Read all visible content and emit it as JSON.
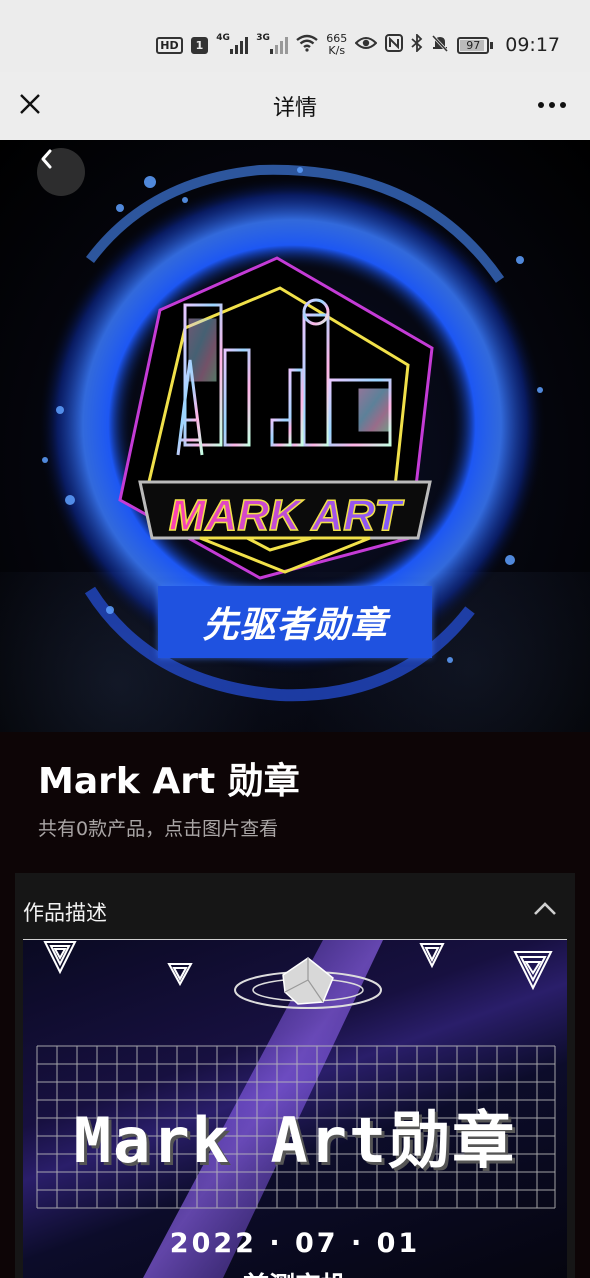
{
  "status_bar": {
    "hd_label": "HD",
    "sim_label": "1",
    "network1": "4G",
    "network2": "3G",
    "speed_value": "665",
    "speed_unit": "K/s",
    "battery": "97",
    "time": "09:17"
  },
  "title_bar": {
    "title": "详情"
  },
  "hero": {
    "logo_text": "MARK ART",
    "banner_text": "先驱者勋章",
    "ring_color": "#1e5bff"
  },
  "product": {
    "title": "Mark Art 勋章",
    "subtitle": "共有0款产品，点击图片查看"
  },
  "description": {
    "label": "作品描述",
    "poster_title": "Mark Art勋章",
    "poster_date": "2022 · 07 · 01",
    "poster_sub": "首测空投"
  },
  "colors": {
    "page_bg": "#0d0506",
    "bar_bg": "#ededed",
    "panel_bg": "#161616",
    "banner_bg": "#1f52e0"
  }
}
